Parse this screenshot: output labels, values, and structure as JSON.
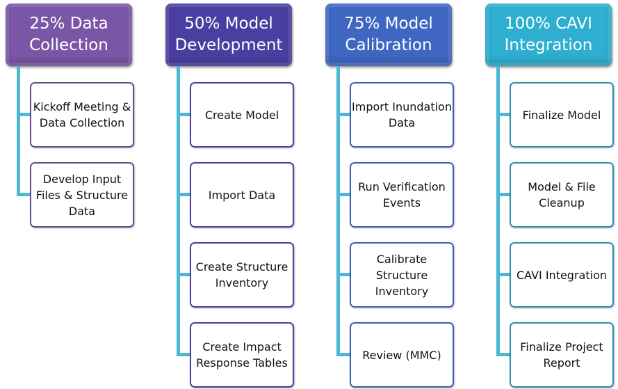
{
  "phases": [
    {
      "title": "25% Data Collection",
      "color": "#7a56a6",
      "border": "#6a4a93",
      "tasks": [
        "Kickoff Meeting & Data Collection",
        "Develop Input Files & Structure Data"
      ]
    },
    {
      "title": "50% Model Development",
      "color": "#4a3ea0",
      "border": "#4a3ea0",
      "tasks": [
        "Create Model",
        "Import Data",
        "Create Structure Inventory",
        "Create Impact Response Tables"
      ]
    },
    {
      "title": "75% Model Calibration",
      "color": "#3f67c2",
      "border": "#3f5fb0",
      "tasks": [
        "Import Inundation Data",
        "Run Verification Events",
        "Calibrate Structure Inventory",
        "Review (MMC)"
      ]
    },
    {
      "title": "100% CAVI Integration",
      "color": "#2eaed0",
      "border": "#2a8fb0",
      "tasks": [
        "Finalize Model",
        "Model & File Cleanup",
        "CAVI Integration",
        "Finalize Project Report"
      ]
    }
  ],
  "connector_color": "#4bb8d4"
}
